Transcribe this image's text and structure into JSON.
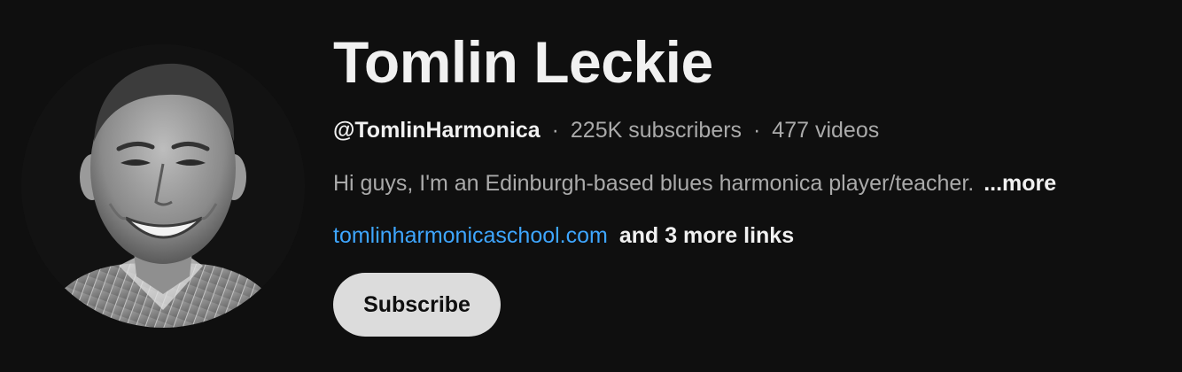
{
  "channel": {
    "name": "Tomlin Leckie",
    "handle": "@TomlinHarmonica",
    "separator": "·",
    "subscribers": "225K subscribers",
    "videos": "477 videos",
    "description": "Hi guys, I'm an Edinburgh-based blues harmonica player/teacher.",
    "more_label": "...more",
    "link_text": "tomlinharmonicaschool.com",
    "more_links": "and 3 more links",
    "subscribe_label": "Subscribe"
  },
  "colors": {
    "background": "#0f0f0f",
    "primary_text": "#f1f1f1",
    "secondary_text": "#aaaaaa",
    "link": "#3ea6ff",
    "subscribe_bg": "#dcdcdc"
  }
}
